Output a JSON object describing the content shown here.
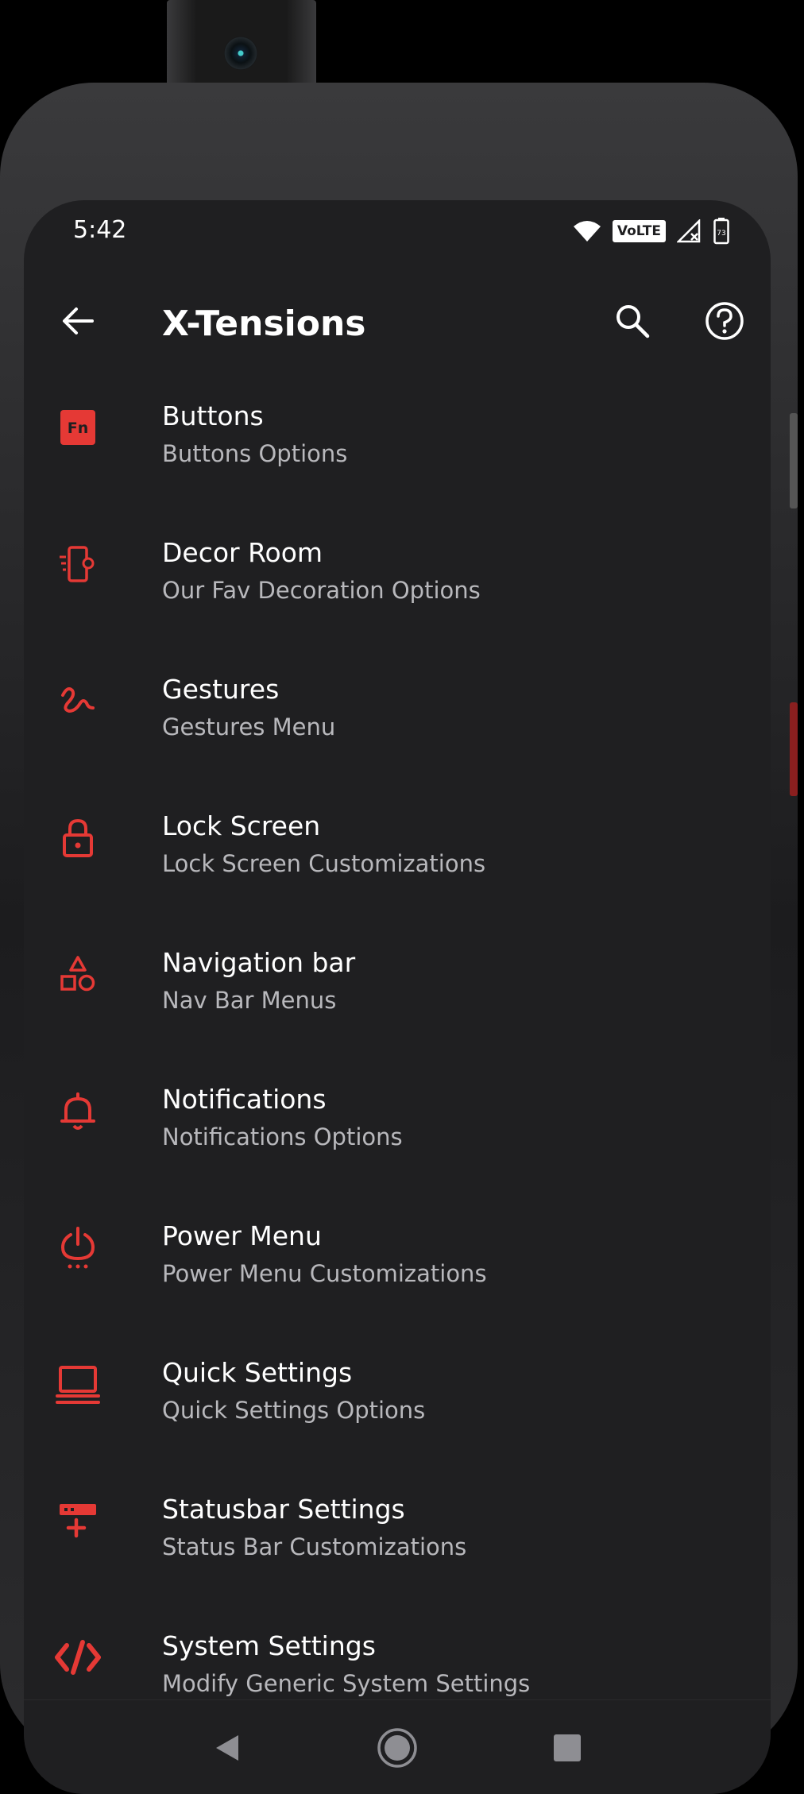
{
  "status": {
    "time": "5:42",
    "network_badge": "VoLTE",
    "battery": "73",
    "icons": [
      "wifi-icon",
      "volte-icon",
      "signal-icon",
      "battery-icon"
    ]
  },
  "toolbar": {
    "title": "X-Tensions",
    "back_icon": "back-arrow-icon",
    "search_icon": "search-icon",
    "help_icon": "help-icon"
  },
  "accent_color": "#e53935",
  "items": [
    {
      "title": "Buttons",
      "subtitle": "Buttons Options",
      "icon": "fn-key-icon",
      "icon_text": "Fn"
    },
    {
      "title": "Decor Room",
      "subtitle": "Our Fav Decoration Options",
      "icon": "phone-settings-icon"
    },
    {
      "title": "Gestures",
      "subtitle": "Gestures Menu",
      "icon": "gesture-icon"
    },
    {
      "title": "Lock Screen",
      "subtitle": "Lock Screen Customizations",
      "icon": "lock-icon"
    },
    {
      "title": "Navigation bar",
      "subtitle": "Nav Bar Menus",
      "icon": "shapes-icon"
    },
    {
      "title": "Notifications",
      "subtitle": "Notifications Options",
      "icon": "bell-icon"
    },
    {
      "title": "Power Menu",
      "subtitle": "Power Menu Customizations",
      "icon": "power-icon"
    },
    {
      "title": "Quick Settings",
      "subtitle": "Quick Settings Options",
      "icon": "laptop-icon"
    },
    {
      "title": "Statusbar Settings",
      "subtitle": "Status Bar Customizations",
      "icon": "statusbar-add-icon"
    },
    {
      "title": "System Settings",
      "subtitle": "Modify Generic System Settings",
      "icon": "code-icon"
    }
  ],
  "navbar": {
    "back": "nav-back-icon",
    "home": "nav-home-icon",
    "recents": "nav-recents-icon"
  }
}
